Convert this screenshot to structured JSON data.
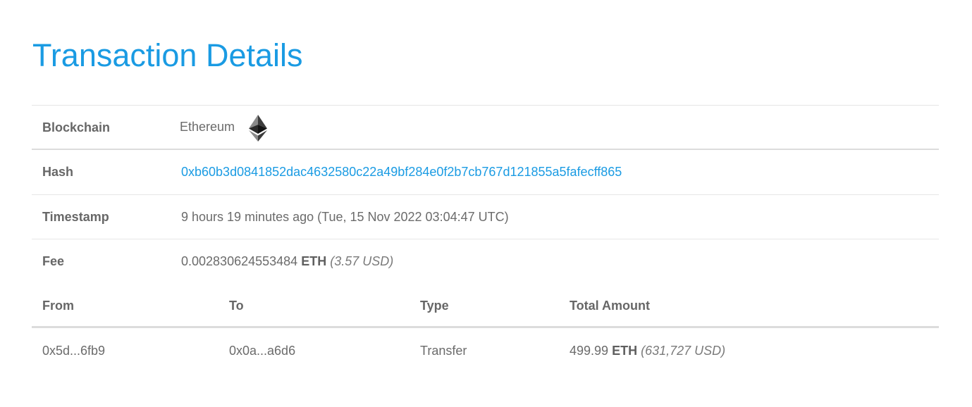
{
  "page_title": "Transaction Details",
  "details": {
    "blockchain": {
      "label": "Blockchain",
      "value": "Ethereum",
      "icon": "ethereum-icon"
    },
    "hash": {
      "label": "Hash",
      "value": "0xb60b3d0841852dac4632580c22a49bf284e0f2b7cb767d121855a5fafecff865"
    },
    "timestamp": {
      "label": "Timestamp",
      "value": "9 hours 19 minutes ago (Tue, 15 Nov 2022 03:04:47 UTC)"
    },
    "fee": {
      "label": "Fee",
      "amount": "0.002830624553484",
      "unit": "ETH",
      "usd": "(3.57 USD)"
    }
  },
  "transfers": {
    "headers": {
      "from": "From",
      "to": "To",
      "type": "Type",
      "total": "Total Amount"
    },
    "rows": [
      {
        "from": "0x5d...6fb9",
        "to": "0x0a...a6d6",
        "type": "Transfer",
        "amount": "499.99",
        "unit": "ETH",
        "usd": "(631,727 USD)"
      }
    ]
  },
  "colors": {
    "accent": "#1a9be3",
    "text": "#666666",
    "divider": "#e6e6e6"
  }
}
